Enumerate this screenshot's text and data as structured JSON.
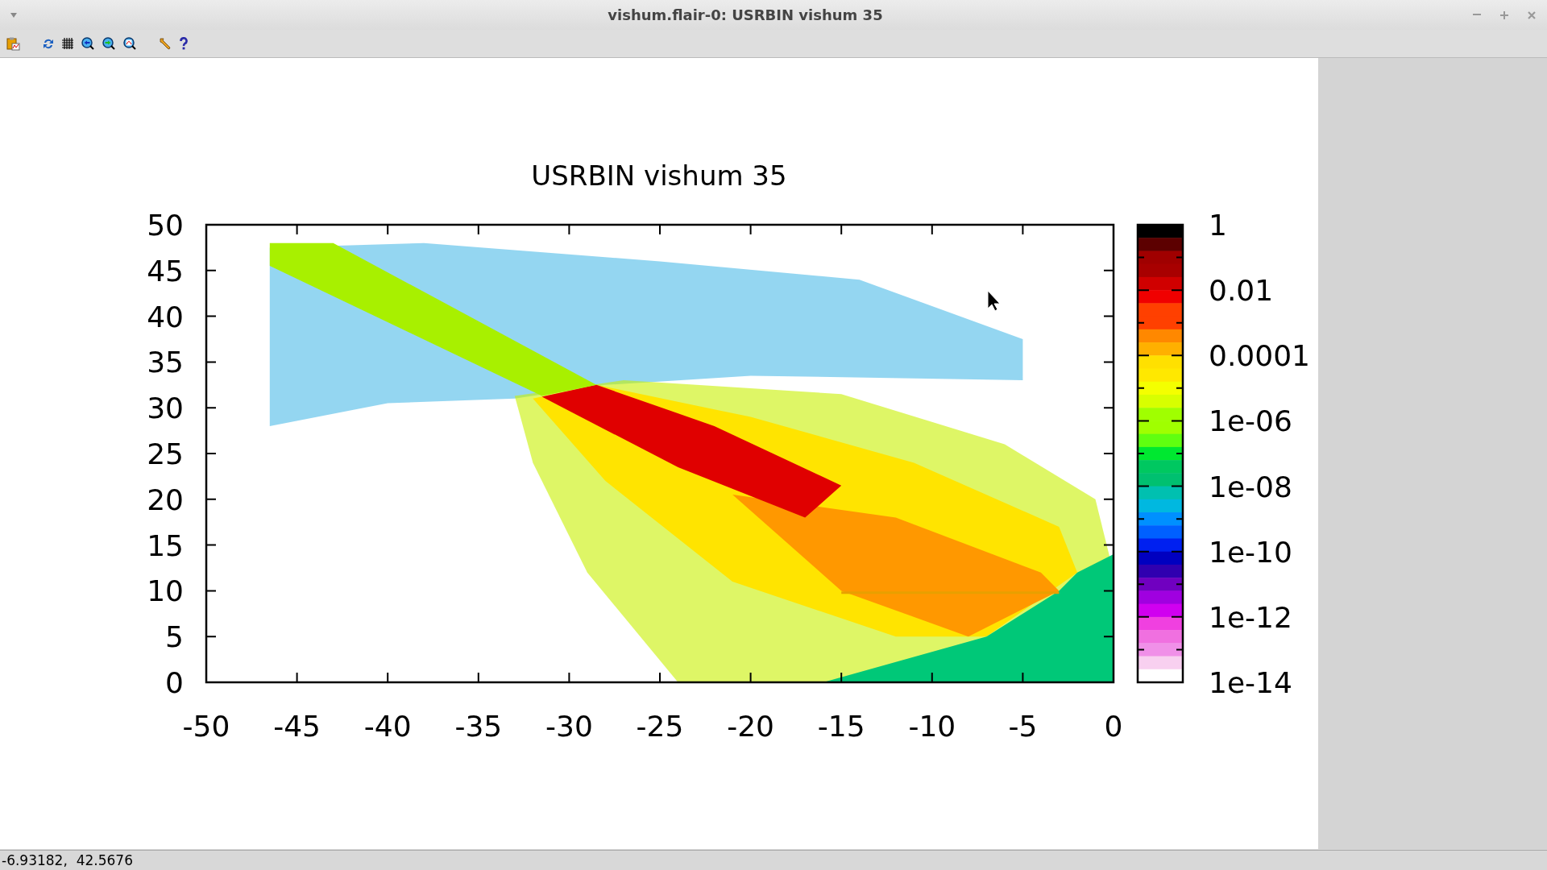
{
  "window": {
    "title": "vishum.flair-0: USRBIN vishum 35"
  },
  "plot": {
    "title": "USRBIN vishum 35",
    "y_ticks": [
      "50",
      "45",
      "40",
      "35",
      "30",
      "25",
      "20",
      "15",
      "10",
      "5",
      "0"
    ],
    "x_ticks": [
      "-50",
      "-45",
      "-40",
      "-35",
      "-30",
      "-25",
      "-20",
      "-15",
      "-10",
      "-5",
      "0"
    ],
    "colorbar_labels": [
      "1",
      "0.01",
      "0.0001",
      "1e-06",
      "1e-08",
      "1e-10",
      "1e-12",
      "1e-14"
    ]
  },
  "status_bar": {
    "coordinates": "-6.93182,  42.5676"
  }
}
